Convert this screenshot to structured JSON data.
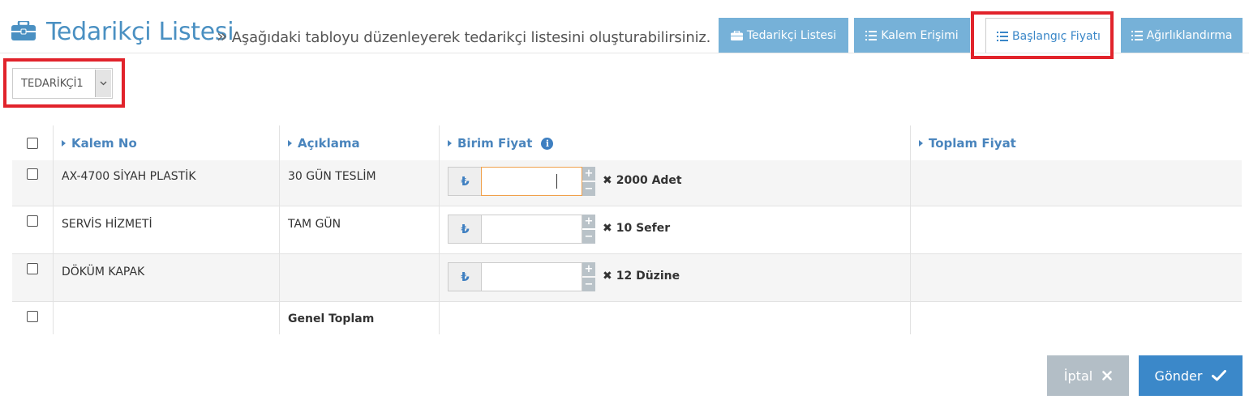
{
  "header": {
    "title": "Tedarikçi Listesi",
    "separator": "»",
    "subtitle": "Aşağıdaki tabloyu düzenleyerek tedarikçi listesini oluşturabilirsiniz.",
    "icon": "briefcase-icon"
  },
  "tabs": [
    {
      "label": "Tedarikçi Listesi",
      "icon": "briefcase-icon",
      "active": false
    },
    {
      "label": "Kalem Erişimi",
      "icon": "list-icon",
      "active": false
    },
    {
      "label": "Başlangıç Fiyatı",
      "icon": "list-icon",
      "active": true
    },
    {
      "label": "Ağırlıklandırma",
      "icon": "list-icon",
      "active": false
    }
  ],
  "supplier_select": {
    "value": "TEDARİKÇİ1"
  },
  "table": {
    "columns": [
      "Kalem No",
      "Açıklama",
      "Birim Fiyat",
      "Toplam Fiyat"
    ],
    "rows": [
      {
        "item_no": "AX-4700 SİYAH PLASTİK",
        "description": "30 GÜN TESLİM",
        "currency": "₺",
        "unit_price": "",
        "quantity": "2000 Adet",
        "total": ""
      },
      {
        "item_no": "SERVİS HİZMETİ",
        "description": "TAM GÜN",
        "currency": "₺",
        "unit_price": "",
        "quantity": "10 Sefer",
        "total": ""
      },
      {
        "item_no": "DÖKÜM KAPAK",
        "description": "",
        "currency": "₺",
        "unit_price": "",
        "quantity": "12 Düzine",
        "total": ""
      }
    ],
    "footer_label": "Genel Toplam"
  },
  "actions": {
    "cancel_label": "İptal",
    "submit_label": "Gönder"
  },
  "colors": {
    "accent": "#4a90c2",
    "tab_bg": "#76b1d8",
    "highlight": "#e1232b",
    "submit": "#3b88c9",
    "cancel": "#b3bec6"
  }
}
